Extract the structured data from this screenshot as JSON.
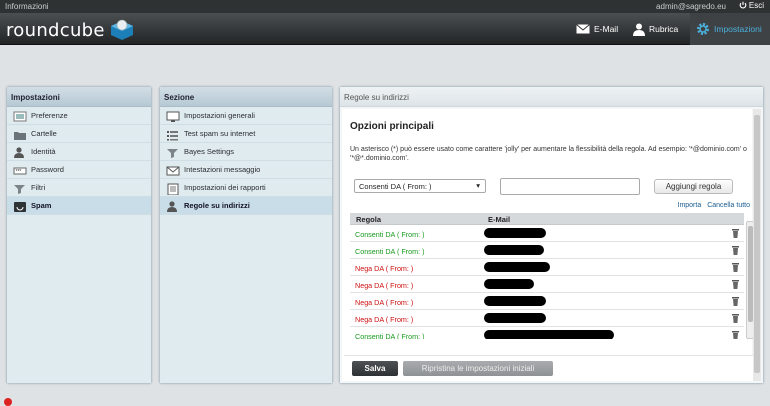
{
  "topline": {
    "info": "Informazioni",
    "user": "admin@sagredo.eu",
    "logout": "Esci"
  },
  "header": {
    "logo": "roundcube"
  },
  "nav": {
    "mail": "E-Mail",
    "contacts": "Rubrica",
    "settings": "Impostazioni"
  },
  "settings_panel": {
    "title": "Impostazioni",
    "items": [
      {
        "label": "Preferenze",
        "icon": "sliders-icon"
      },
      {
        "label": "Cartelle",
        "icon": "folder-icon"
      },
      {
        "label": "Identità",
        "icon": "person-icon"
      },
      {
        "label": "Password",
        "icon": "password-icon"
      },
      {
        "label": "Filtri",
        "icon": "filter-icon"
      },
      {
        "label": "Spam",
        "icon": "spam-icon",
        "selected": true
      }
    ]
  },
  "section_panel": {
    "title": "Sezione",
    "items": [
      {
        "label": "Impostazioni generali",
        "icon": "monitor-icon"
      },
      {
        "label": "Test spam su internet",
        "icon": "list-icon"
      },
      {
        "label": "Bayes Settings",
        "icon": "filter-icon"
      },
      {
        "label": "Intestazioni messaggio",
        "icon": "envelope-icon"
      },
      {
        "label": "Impostazioni dei rapporti",
        "icon": "report-icon"
      },
      {
        "label": "Regole su indirizzi",
        "icon": "person-icon",
        "selected": true
      }
    ]
  },
  "main": {
    "title": "Regole su indirizzi",
    "heading": "Opzioni principali",
    "description": "Un asterisco (*) può essere usato come carattere 'jolly' per aumentare la flessibilità della regola. Ad esempio: '*@dominio.com' o '*@*.dominio.com'.",
    "rule_select": "Consenti DA ( From: )",
    "add_button": "Aggiungi regola",
    "import_link": "Importa",
    "clear_link": "Cancella tutto",
    "col_rule": "Regola",
    "col_email": "E-Mail",
    "rows": [
      {
        "action": "Consenti DA ( From: )",
        "type": "allow"
      },
      {
        "action": "Consenti DA ( From: )",
        "type": "allow"
      },
      {
        "action": "Nega DA ( From: )",
        "type": "deny"
      },
      {
        "action": "Nega DA ( From: )",
        "type": "deny"
      },
      {
        "action": "Nega DA ( From: )",
        "type": "deny"
      },
      {
        "action": "Nega DA ( From: )",
        "type": "deny"
      },
      {
        "action": "Consenti DA ( From: )",
        "type": "allow"
      }
    ],
    "save_button": "Salva",
    "reset_button": "Ripristina le impostazioni iniziali"
  },
  "colors": {
    "accent": "#4ab0dd",
    "allow": "#199a1f",
    "deny": "#cc1111"
  }
}
